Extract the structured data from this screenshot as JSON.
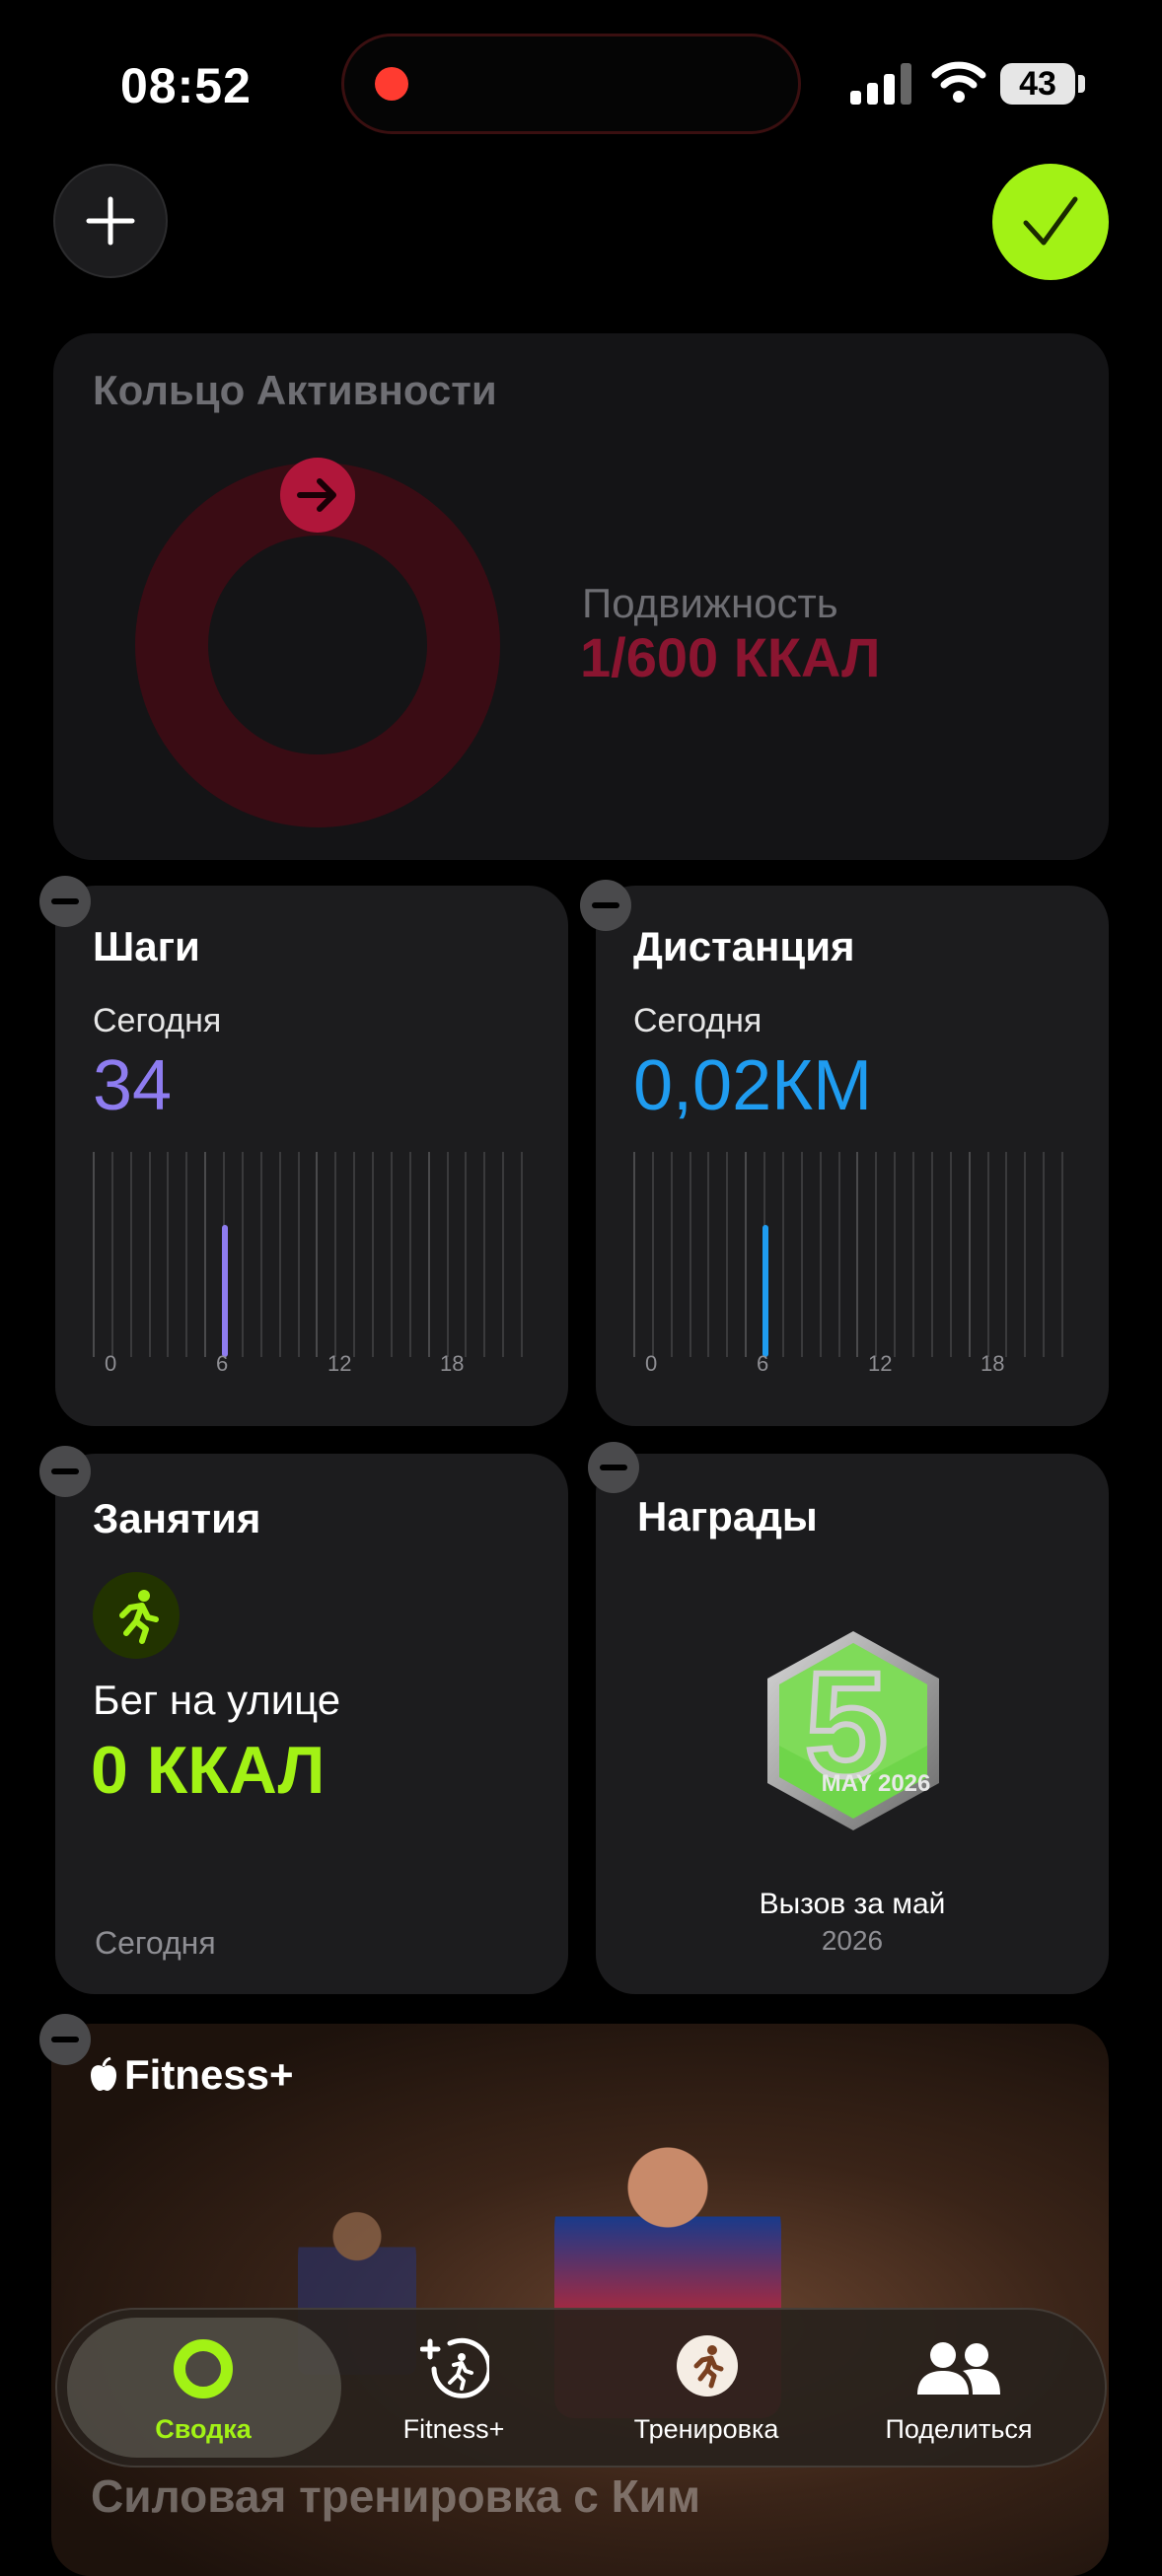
{
  "status_bar": {
    "time": "08:52",
    "battery": "43"
  },
  "activity_ring": {
    "title": "Кольцо Активности",
    "move_label": "Подвижность",
    "move_value": "1/600 ККАЛ",
    "move_color": "#e0204a"
  },
  "steps": {
    "title": "Шаги",
    "period": "Сегодня",
    "value": "34",
    "color": "#8e7cf0",
    "ticks": [
      "0",
      "6",
      "12",
      "18"
    ]
  },
  "distance": {
    "title": "Дистанция",
    "period": "Сегодня",
    "value": "0,02КМ",
    "color": "#1f9cf0",
    "ticks": [
      "0",
      "6",
      "12",
      "18"
    ]
  },
  "workouts": {
    "title": "Занятия",
    "activity": "Бег на улице",
    "value": "0 ККАЛ",
    "period": "Сегодня",
    "color": "#a2f215",
    "icon": "runner-icon"
  },
  "awards": {
    "title": "Награды",
    "award_name": "Вызов за май",
    "award_year": "2026",
    "badge_number": "5",
    "badge_text": "MAY 2026"
  },
  "fitness_plus": {
    "brand": "Fitness+",
    "workout_title": "Силовая тренировка с Ким"
  },
  "tabs": [
    {
      "label": "Сводка",
      "icon": "ring-icon",
      "selected": true
    },
    {
      "label": "Fitness+",
      "icon": "fitness-plus-icon",
      "selected": false
    },
    {
      "label": "Тренировка",
      "icon": "runner-icon",
      "selected": false
    },
    {
      "label": "Поделиться",
      "icon": "people-icon",
      "selected": false
    }
  ],
  "colors": {
    "accent": "#a2f215",
    "background": "#000000",
    "card": "#1c1c1e"
  }
}
